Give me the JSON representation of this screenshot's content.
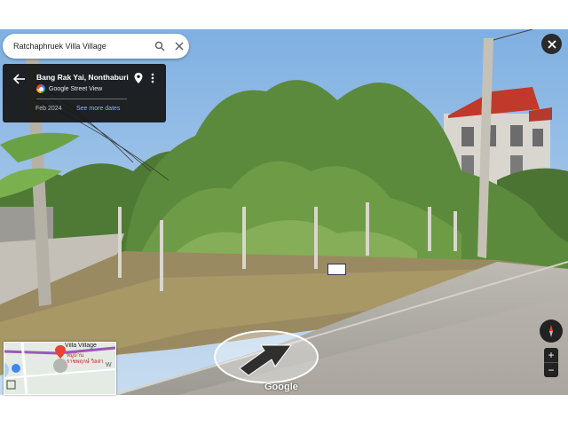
{
  "search": {
    "query": "Ratchaphruek Villa Village"
  },
  "info": {
    "title": "Bang Rak Yai, Nonthaburi",
    "provider": "Google Street View",
    "date": "Feb 2024",
    "see_more": "See more dates"
  },
  "minimap": {
    "place_en": "Villa Village",
    "place_th_1": "หมู่บ้าน",
    "place_th_2": "ราชพฤกษ์ วิลล่า",
    "road_label": "W"
  },
  "controls": {
    "zoom_in": "+",
    "zoom_out": "−"
  },
  "branding": {
    "logo": "Google"
  },
  "colors": {
    "accent": "#1a73e8",
    "panel": "#141414",
    "sky": "#8ab7e6"
  }
}
